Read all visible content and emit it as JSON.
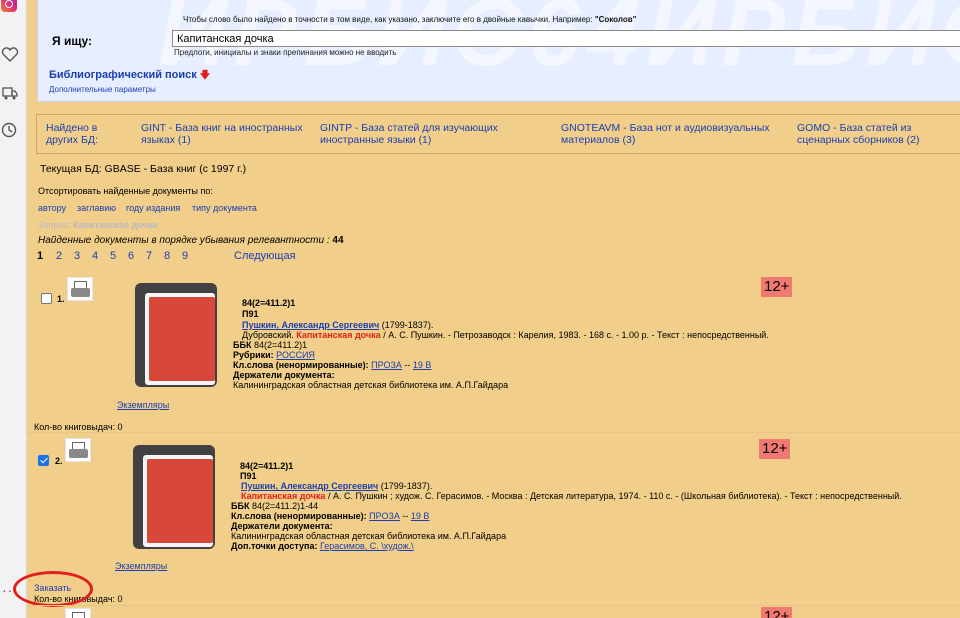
{
  "sidebar": {
    "icons": [
      "instagram-icon",
      "heart-icon",
      "truck-icon",
      "clock-icon"
    ],
    "more": "···"
  },
  "search": {
    "hint_prefix": "Чтобы слово было найдено в точности в том виде, как указано, заключите его в двойные кавычки. Например: ",
    "hint_example": "\"Соколов\"",
    "label": "Я ищу:",
    "query": "Капитанская дочка",
    "note": "Предлоги, инициалы и знаки препинания можно не вводить",
    "mode": "Библиографический поиск",
    "advanced": "Дополнительные параметры",
    "watermark": "ИРБИС64ИРБИС64"
  },
  "other_db": {
    "label": "Найдено в других БД:",
    "items": [
      "GINT - База книг на иностранных языках (1)",
      "GINTP - База статей для изучающих иностранные языки (1)",
      "GNOTEAVM - База нот и аудиовизуальных материалов (3)",
      "GOMO - База статей из сценарных сборников (2)"
    ]
  },
  "current_db": "Текущая БД: GBASE - База книг (с 1997 г.)",
  "sort": {
    "label": "Отсортировать найденные документы по:",
    "options": [
      "автору",
      "заглавию",
      "году издания",
      "типу документа"
    ]
  },
  "query_line": {
    "label": "Запрос:",
    "value": "Капитанская дочка"
  },
  "found": {
    "label": "Найденные документы в порядке убывания релевантности : ",
    "count": "44"
  },
  "pager": {
    "pages": [
      "1",
      "2",
      "3",
      "4",
      "5",
      "6",
      "7",
      "8",
      "9"
    ],
    "current": "1",
    "next": "Следующая"
  },
  "records": [
    {
      "num": "1.",
      "checked": false,
      "age": "12+",
      "code": "84(2=411.2)1",
      "sign": "П91",
      "author": "Пушкин, Александр Сергеевич",
      "years": "(1799-1837).",
      "pre_title": "Дубровский.",
      "title": "Капитанская дочка",
      "desc": "/ А. С. Пушкин. - Петрозаводск : Карелия, 1983. - 168 с. - 1.00 р. - Текст : непосредственный.",
      "bbk_label": "ББК",
      "bbk": "84(2=411.2)1",
      "rubrics_label": "Рубрики:",
      "rubric": "РОССИЯ",
      "kw_label": "Кл.слова (ненормированные):",
      "kw1": "ПРОЗА",
      "kw_sep": "--",
      "kw2": "19 В",
      "holders_label": "Держатели документа:",
      "holder": "Калининградская областная детская библиотека им. А.П.Гайдара",
      "copies": "Экземпляры",
      "loans": "Кол-во книговыдач: 0"
    },
    {
      "num": "2.",
      "checked": true,
      "age": "12+",
      "code": "84(2=411.2)1",
      "sign": "П91",
      "author": "Пушкин, Александр Сергеевич",
      "years": "(1799-1837).",
      "title": "Капитанская дочка",
      "desc": "/ А. С. Пушкин ; худож. С. Герасимов. - Москва : Детская литература, 1974. - 110 с. - (Школьная библиотека). - Текст : непосредственный.",
      "bbk_label": "ББК",
      "bbk": "84(2=411.2)1-44",
      "kw_label": "Кл.слова (ненормированные):",
      "kw1": "ПРОЗА",
      "kw_sep": "--",
      "kw2": "19 В",
      "holders_label": "Держатели документа:",
      "holder": "Калининградская областная детская библиотека им. А.П.Гайдара",
      "access_label": "Доп.точки доступа:",
      "access": "Герасимов, С. \\худож.\\",
      "copies": "Экземпляры",
      "order": "Заказать",
      "loans": "Кол-во книговыдач: 0"
    }
  ],
  "third_record_age": "12+"
}
